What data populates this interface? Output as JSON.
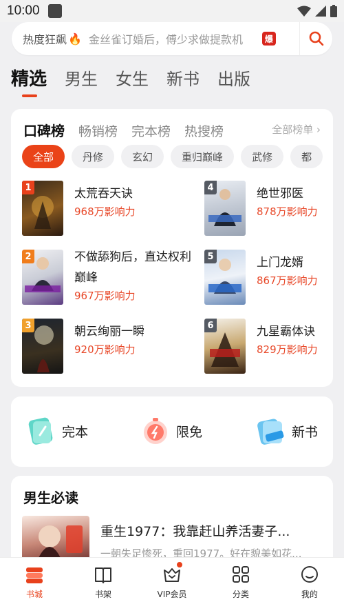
{
  "status": {
    "time": "10:00"
  },
  "search": {
    "hot_label": "热度狂飙",
    "placeholder": "金丝雀订婚后，傅少求做提款机",
    "badge": "爆"
  },
  "main_tabs": [
    "精选",
    "男生",
    "女生",
    "新书",
    "出版"
  ],
  "ranking": {
    "tabs": [
      "口碑榜",
      "畅销榜",
      "完本榜",
      "热搜榜"
    ],
    "all_link": "全部榜单",
    "chips": [
      "全部",
      "丹修",
      "玄幻",
      "重归巅峰",
      "武修",
      "都"
    ],
    "books": [
      {
        "rank": "1",
        "title": "太荒吞天诀",
        "score": "968万影响力"
      },
      {
        "rank": "2",
        "title": "不做舔狗后，直达权利巅峰",
        "score": "967万影响力"
      },
      {
        "rank": "3",
        "title": "朝云绚丽一瞬",
        "score": "920万影响力"
      },
      {
        "rank": "4",
        "title": "绝世邪医",
        "score": "878万影响力"
      },
      {
        "rank": "5",
        "title": "上门龙婿",
        "score": "867万影响力"
      },
      {
        "rank": "6",
        "title": "九星霸体诀",
        "score": "829万影响力"
      }
    ],
    "cover_texts": [
      "太荒吞天诀",
      "直达权利巅峰",
      "",
      "绝世邪医",
      "上门龙婿",
      "九星霸体诀"
    ]
  },
  "quick": [
    {
      "label": "完本",
      "icon": "book-complete-icon"
    },
    {
      "label": "限免",
      "icon": "timer-free-icon"
    },
    {
      "label": "新书",
      "icon": "new-book-icon"
    }
  ],
  "must_read": {
    "title": "男生必读",
    "book_title": "重生1977：我靠赶山养活妻子...",
    "book_desc": "一朝失足惨死，重回1977。好在貌美如花..."
  },
  "nav": [
    {
      "label": "书城",
      "icon": "bookstore-icon"
    },
    {
      "label": "书架",
      "icon": "bookshelf-icon"
    },
    {
      "label": "VIP会员",
      "icon": "vip-crown-icon"
    },
    {
      "label": "分类",
      "icon": "category-grid-icon"
    },
    {
      "label": "我的",
      "icon": "profile-icon"
    }
  ],
  "colors": {
    "accent": "#e8411c",
    "rank_gold": "#f0a02c",
    "rank_gray": "#555a63"
  }
}
